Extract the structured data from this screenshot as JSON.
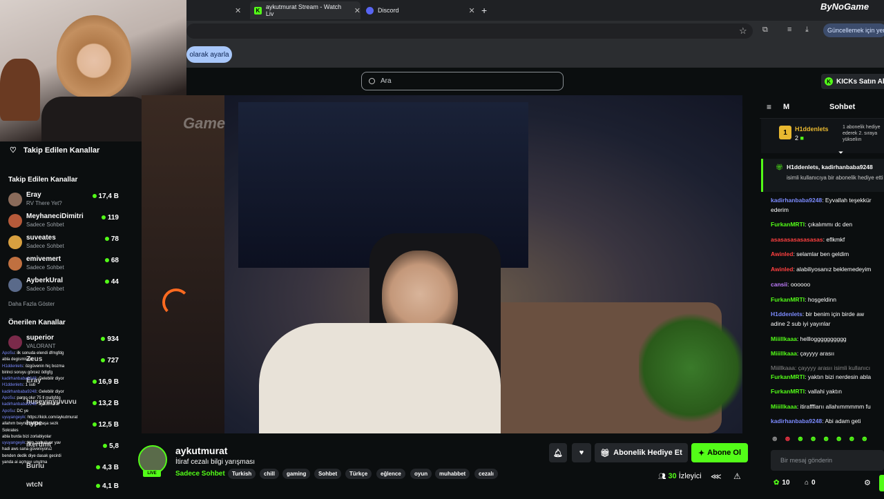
{
  "browser": {
    "tabs": [
      {
        "title": "aykutmurat Stream - Watch Liv"
      },
      {
        "title": "Discord"
      }
    ],
    "bookmark_pill": "olarak ayarla",
    "update_label": "Güncellemek için yenid",
    "watermark": "ByNoGame"
  },
  "kick": {
    "search_placeholder": "Ara",
    "kicks_button": "KICKs Satın Al"
  },
  "sidebar": {
    "followed_title": "Takip Edilen Kanallar",
    "followed_section": "Takip Edilen Kanallar",
    "followed": [
      {
        "name": "Eray",
        "sub": "RV There Yet?",
        "viewers": "17,4 B",
        "color": "#8a6b5a"
      },
      {
        "name": "MeyhaneciDimitri",
        "sub": "Sadece Sohbet",
        "viewers": "119",
        "color": "#b65a3a"
      },
      {
        "name": "suveates",
        "sub": "Sadece Sohbet",
        "viewers": "78",
        "color": "#d8a040"
      },
      {
        "name": "emivemert",
        "sub": "Sadece Sohbet",
        "viewers": "68",
        "color": "#c07040"
      },
      {
        "name": "AyberkUral",
        "sub": "Sadece Sohbet",
        "viewers": "44",
        "color": "#5a6a8a"
      }
    ],
    "show_more": "Daha Fazla Göster",
    "recommended_section": "Önerilen Kanallar",
    "recommended": [
      {
        "name": "superior",
        "sub": "VALORANT",
        "viewers": "934"
      },
      {
        "name": "Zeus",
        "sub": "",
        "viewers": "727"
      },
      {
        "name": "Eray",
        "sub": "",
        "viewers": "16,9 B"
      },
      {
        "name": "huseyinyuvuvu",
        "sub": "",
        "viewers": "13,2 B"
      },
      {
        "name": "hype",
        "sub": "",
        "viewers": "12,5 B"
      },
      {
        "name": "ikerdmt",
        "sub": "",
        "viewers": "5,8"
      },
      {
        "name": "Burlu",
        "sub": "",
        "viewers": "4,3 B"
      },
      {
        "name": "wtcN",
        "sub": "",
        "viewers": "4,1 B"
      }
    ]
  },
  "overlay_chat": [
    {
      "u": "ApoSu",
      "t": "ilk sonuda elendi dfmgfdg"
    },
    {
      "u": "",
      "t": "abla degismissin"
    },
    {
      "u": "H1ddenlets",
      "t": "özgüvenin hiç bozma"
    },
    {
      "u": "",
      "t": "birinci soruyu görcez ödlgfg"
    },
    {
      "u": "kadirhanbaba9248",
      "t": "Gelebilir diyor"
    },
    {
      "u": "H1ddenlets",
      "t": "1 sub"
    },
    {
      "u": "kadirhanbaba9248",
      "t": "Gelebilir diyor"
    },
    {
      "u": "ApoSu",
      "t": "pargo olur 75 tl mafgfdg"
    },
    {
      "u": "kadirhanbaba9248",
      "t": "aykutmurat"
    },
    {
      "u": "ApoSu",
      "t": "DC ye"
    },
    {
      "u": "uyuyangeyik",
      "t": "https://kick.com/aykutmurat"
    },
    {
      "u": "",
      "t": "allahım beynin yokuş aşa sezk"
    },
    {
      "u": "",
      "t": "Sokrates"
    },
    {
      "u": "",
      "t": "abla burda bizi zorlabiyolar"
    },
    {
      "u": "uyuyangeyik",
      "t": "kim zorbalıyor yav"
    },
    {
      "u": "",
      "t": "hadi aws sana güveniyoruz"
    },
    {
      "u": "",
      "t": "benden dedik diye dasak gecirdi"
    },
    {
      "u": "",
      "t": "yanda ai açmayı unutma"
    }
  ],
  "stream": {
    "streamer": "aykutmurat",
    "title": "İtiraf cezalı bilgi yarışması",
    "category": "Sadece Sohbet",
    "live": "LIVE",
    "tags": [
      "Turkish",
      "chill",
      "gaming",
      "Sohbet",
      "Türkçe",
      "eğlence",
      "oyun",
      "muhabbet",
      "cezalı"
    ],
    "gift_button": "Abonelik Hediye Et",
    "subscribe_button": "Abone Ol",
    "viewer_count": "30",
    "viewer_label": "İzleyici",
    "video_watermark": "Game"
  },
  "chat": {
    "header": "Sohbet",
    "mode_letter": "M",
    "pinned_user": "H1ddenlets",
    "pinned_count": "2",
    "pinned_rank": "1",
    "pinned_note": "1 abonelik hediye ederek 2. sıraya yükseliın",
    "gift_msg_user": "H1ddenlets, kadirhanbaba9248",
    "gift_msg_text": "isimli kullanıcıya bir abonelik hediye etti",
    "messages": [
      {
        "u": "kadirhanbaba9248",
        "c": "#7c8bff",
        "t": ": Eyvallah teşekkür"
      },
      {
        "u": "",
        "c": "#fff",
        "t": "ederim"
      },
      {
        "u": "FurkanMRTI",
        "c": "#53fc18",
        "t": ": çıkalımmı dc den"
      },
      {
        "u": "asasasasasasasas",
        "c": "#ff4040",
        "t": ": eflkmkf"
      },
      {
        "u": "Awinled",
        "c": "#ff4040",
        "t": ": selamlar ben geldim"
      },
      {
        "u": "Awinled",
        "c": "#ff4040",
        "t": ": alabiliyosanız beklemedeyim"
      },
      {
        "u": "cansii",
        "c": "#c07cff",
        "t": ": oooooo"
      },
      {
        "u": "FurkanMRTI",
        "c": "#53fc18",
        "t": ": hoşgeldinn"
      },
      {
        "u": "H1ddenlets",
        "c": "#7c8bff",
        "t": ": bir benim için birde aw"
      },
      {
        "u": "",
        "c": "#fff",
        "t": "adine 2 sub iyi yayınlar"
      },
      {
        "u": "Miiillkaaa",
        "c": "#53fc18",
        "t": ": helllogggggggggg"
      },
      {
        "u": "Miiillkaaa",
        "c": "#53fc18",
        "t": ": çayyyy arasıı"
      },
      {
        "u": "",
        "c": "#888",
        "t": "Miiillkaaa: çayyyy arasıı isimli kullanıcı"
      },
      {
        "u": "FurkanMRTI",
        "c": "#53fc18",
        "t": ": yaktın bizi nerdesin abla"
      },
      {
        "u": "FurkanMRTI",
        "c": "#53fc18",
        "t": ": vallahi yaktın"
      },
      {
        "u": "Miiillkaaa",
        "c": "#53fc18",
        "t": ": itiraffflarıı allahımmmmm fu"
      },
      {
        "u": "kadirhanbaba9248",
        "c": "#7c8bff",
        "t": ": Abi adam geti"
      }
    ],
    "input_placeholder": "Bir mesaj gönderin",
    "points": "10",
    "other_count": "0"
  }
}
